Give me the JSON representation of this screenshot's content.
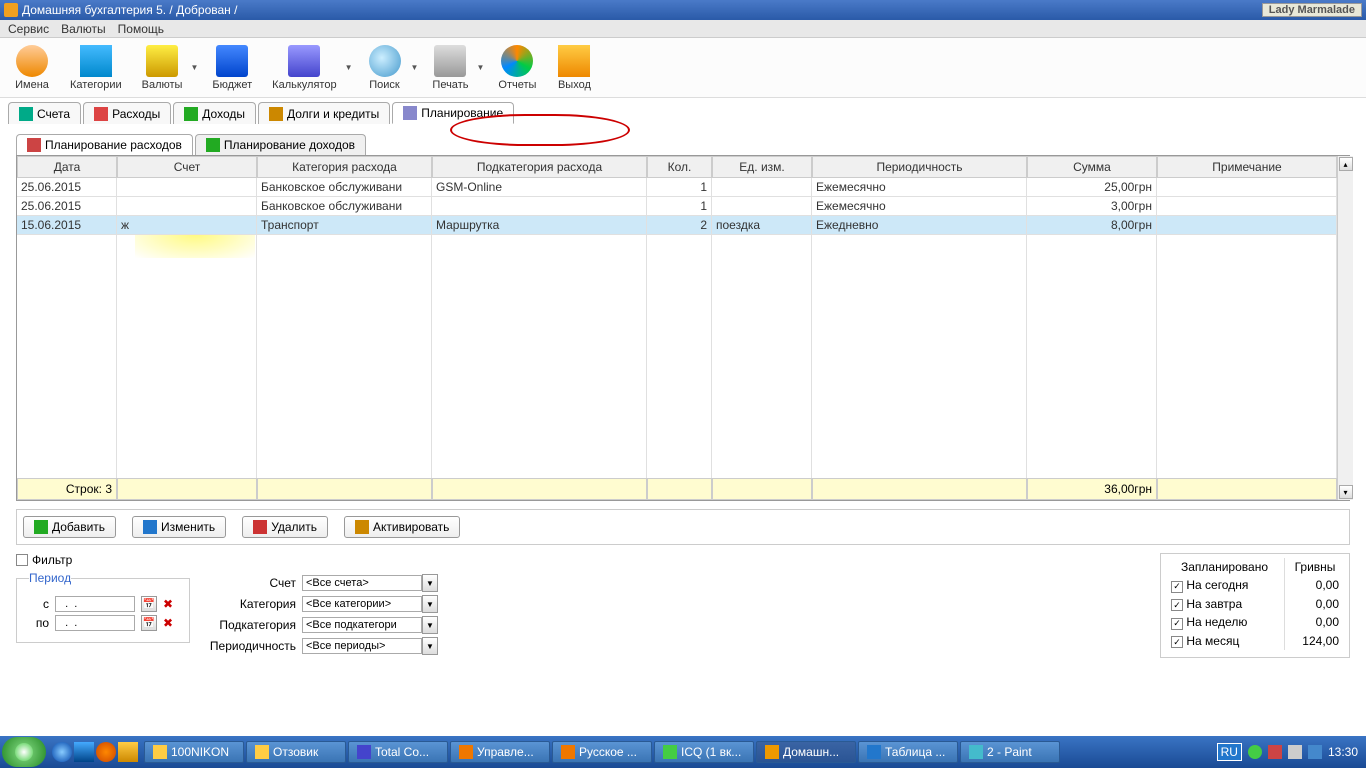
{
  "titlebar": {
    "text": "Домашняя бухгалтерия 5.  / Доброван /",
    "watermark": "Lady Marmalade"
  },
  "menu": [
    "Сервис",
    "Валюты",
    "Помощь"
  ],
  "toolbar": [
    {
      "id": "names",
      "label": "Имена",
      "icon": "ic-people",
      "dd": false
    },
    {
      "id": "categories",
      "label": "Категории",
      "icon": "ic-cat",
      "dd": false
    },
    {
      "id": "currencies",
      "label": "Валюты",
      "icon": "ic-cur",
      "dd": true
    },
    {
      "id": "budget",
      "label": "Бюджет",
      "icon": "ic-bud",
      "dd": false
    },
    {
      "id": "calculator",
      "label": "Калькулятор",
      "icon": "ic-calc",
      "dd": true
    },
    {
      "id": "search",
      "label": "Поиск",
      "icon": "ic-search",
      "dd": true
    },
    {
      "id": "print",
      "label": "Печать",
      "icon": "ic-print",
      "dd": true
    },
    {
      "id": "reports",
      "label": "Отчеты",
      "icon": "ic-rep",
      "dd": false
    },
    {
      "id": "exit",
      "label": "Выход",
      "icon": "ic-exit",
      "dd": false
    }
  ],
  "maintabs": [
    {
      "id": "accounts",
      "label": "Счета",
      "active": false,
      "color": "#0a8"
    },
    {
      "id": "expenses",
      "label": "Расходы",
      "active": false,
      "color": "#d44"
    },
    {
      "id": "income",
      "label": "Доходы",
      "active": false,
      "color": "#2a2"
    },
    {
      "id": "debts",
      "label": "Долги и кредиты",
      "active": false,
      "color": "#c80"
    },
    {
      "id": "planning",
      "label": "Планирование",
      "active": true,
      "color": "#88c"
    }
  ],
  "subtabs": [
    {
      "id": "plan-exp",
      "label": "Планирование расходов",
      "active": true,
      "color": "#c44"
    },
    {
      "id": "plan-inc",
      "label": "Планирование доходов",
      "active": false,
      "color": "#2a2"
    }
  ],
  "columns": [
    "Дата",
    "Счет",
    "Категория расхода",
    "Подкатегория расхода",
    "Кол.",
    "Ед. изм.",
    "Периодичность",
    "Сумма",
    "Примечание"
  ],
  "rows": [
    {
      "date": "25.06.2015",
      "acc": "",
      "cat": "Банковское обслуживани",
      "sub": "GSM-Online",
      "qty": "1",
      "unit": "",
      "per": "Ежемесячно",
      "sum": "25,00грн",
      "note": "",
      "sel": false
    },
    {
      "date": "25.06.2015",
      "acc": "",
      "cat": "Банковское обслуживани",
      "sub": "",
      "qty": "1",
      "unit": "",
      "per": "Ежемесячно",
      "sum": "3,00грн",
      "note": "",
      "sel": false
    },
    {
      "date": "15.06.2015",
      "acc": "ж",
      "cat": "Транспорт",
      "sub": "Маршрутка",
      "qty": "2",
      "unit": "поездка",
      "per": "Ежедневно",
      "sum": "8,00грн",
      "note": "",
      "sel": true
    }
  ],
  "footer": {
    "rows_label": "Строк: 3",
    "total": "36,00грн"
  },
  "actions": [
    {
      "id": "add",
      "label": "Добавить",
      "color": "#2a2"
    },
    {
      "id": "edit",
      "label": "Изменить",
      "color": "#27c"
    },
    {
      "id": "delete",
      "label": "Удалить",
      "color": "#c33"
    },
    {
      "id": "activate",
      "label": "Активировать",
      "color": "#c80"
    }
  ],
  "filter": {
    "title": "Фильтр",
    "period_label": "Период",
    "from_label": "с",
    "to_label": "по",
    "date_placeholder": "  .  .    ",
    "acc_label": "Счет",
    "acc_val": "<Все счета>",
    "cat_label": "Категория",
    "cat_val": "<Все категории>",
    "sub_label": "Подкатегория",
    "sub_val": "<Все подкатегори",
    "per_label": "Периодичность",
    "per_val": "<Все периоды>"
  },
  "summary": {
    "head1": "Запланировано",
    "head2": "Гривны",
    "rows": [
      {
        "label": "На сегодня",
        "val": "0,00"
      },
      {
        "label": "На завтра",
        "val": "0,00"
      },
      {
        "label": "На неделю",
        "val": "0,00"
      },
      {
        "label": "На месяц",
        "val": "124,00"
      }
    ]
  },
  "taskbar": {
    "tasks": [
      {
        "id": "nikon",
        "label": "100NIKON",
        "color": "#fc4"
      },
      {
        "id": "otzovik",
        "label": "Отзовик",
        "color": "#fc4"
      },
      {
        "id": "totalc",
        "label": "Total Co...",
        "color": "#44c"
      },
      {
        "id": "ff1",
        "label": "Управле...",
        "color": "#e70"
      },
      {
        "id": "ff2",
        "label": "Русское ...",
        "color": "#e70"
      },
      {
        "id": "icq",
        "label": "ICQ (1 вк...",
        "color": "#4c4"
      },
      {
        "id": "home",
        "label": "Домашн...",
        "color": "#e90",
        "active": true
      },
      {
        "id": "table",
        "label": "Таблица ...",
        "color": "#27c"
      },
      {
        "id": "paint",
        "label": "2 - Paint",
        "color": "#4bc"
      }
    ],
    "lang": "RU",
    "time": "13:30"
  }
}
